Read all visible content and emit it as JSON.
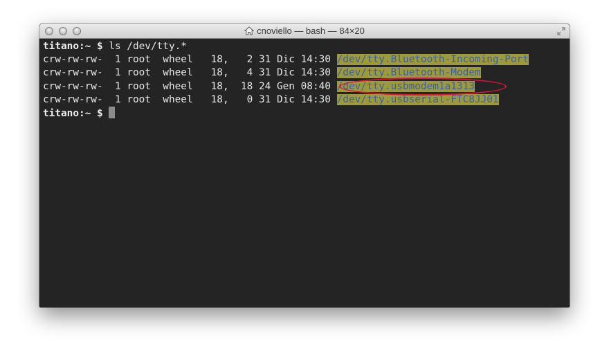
{
  "window": {
    "title": "cnoviello — bash — 84×20"
  },
  "terminal": {
    "command_prompt": "titano:~ $ ",
    "command": "ls /dev/tty.*",
    "rows": [
      {
        "perms": "crw-rw-rw-",
        "links": "1",
        "owner": "root",
        "group": "wheel",
        "major": "18,",
        "minor": "2",
        "day": "31",
        "month": "Dic",
        "time": "14:30",
        "path": "/dev/tty.Bluetooth-Incoming-Port"
      },
      {
        "perms": "crw-rw-rw-",
        "links": "1",
        "owner": "root",
        "group": "wheel",
        "major": "18,",
        "minor": "4",
        "day": "31",
        "month": "Dic",
        "time": "14:30",
        "path": "/dev/tty.Bluetooth-Modem"
      },
      {
        "perms": "crw-rw-rw-",
        "links": "1",
        "owner": "root",
        "group": "wheel",
        "major": "18,",
        "minor": "18",
        "day": "24",
        "month": "Gen",
        "time": "08:40",
        "path": "/dev/tty.usbmodem1a1313"
      },
      {
        "perms": "crw-rw-rw-",
        "links": "1",
        "owner": "root",
        "group": "wheel",
        "major": "18,",
        "minor": "0",
        "day": "31",
        "month": "Dic",
        "time": "14:30",
        "path": "/dev/tty.usbserial-FTC8JJ01"
      }
    ],
    "final_prompt": "titano:~ $ "
  },
  "colors": {
    "terminal_bg": "#242424",
    "path_highlight_bg": "#9c9a3a",
    "path_text": "#3b5fa3",
    "annotation_ellipse": "#e0123c"
  },
  "icons": {
    "title_icon": "home-icon",
    "resize": "fullscreen-icon"
  }
}
